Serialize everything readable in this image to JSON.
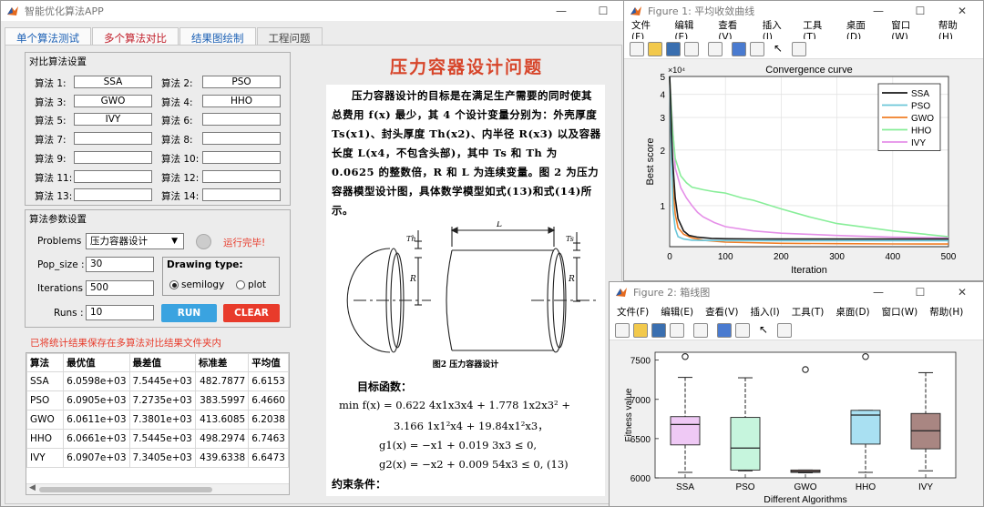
{
  "app": {
    "title": "智能优化算法APP",
    "tabs": [
      "单个算法测试",
      "多个算法对比",
      "结果图绘制",
      "工程问题"
    ],
    "tab_colors": [
      "#1a5fb4",
      "#c01c28",
      "#1a5fb4",
      "#444444"
    ],
    "page_heading": "压力容器设计问题",
    "compare_panel": {
      "title": "对比算法设置",
      "slots": [
        {
          "label": "算法 1:",
          "value": "SSA"
        },
        {
          "label": "算法 2:",
          "value": "PSO"
        },
        {
          "label": "算法 3:",
          "value": "GWO"
        },
        {
          "label": "算法 4:",
          "value": "HHO"
        },
        {
          "label": "算法 5:",
          "value": "IVY"
        },
        {
          "label": "算法 6:",
          "value": ""
        },
        {
          "label": "算法 7:",
          "value": ""
        },
        {
          "label": "算法 8:",
          "value": ""
        },
        {
          "label": "算法 9:",
          "value": ""
        },
        {
          "label": "算法 10:",
          "value": ""
        },
        {
          "label": "算法 11:",
          "value": ""
        },
        {
          "label": "算法 12:",
          "value": ""
        },
        {
          "label": "算法 13:",
          "value": ""
        },
        {
          "label": "算法 14:",
          "value": ""
        }
      ]
    },
    "param_panel": {
      "title": "算法参数设置",
      "problems_label": "Problems :",
      "problems_value": "压力容器设计",
      "status": "运行完毕!",
      "pop_label": "Pop_size :",
      "pop_value": "30",
      "iter_label": "Iterations :",
      "iter_value": "500",
      "runs_label": "Runs :",
      "runs_value": "10",
      "drawing_label": "Drawing type:",
      "opt_semilogy": "semilogy",
      "opt_plot": "plot",
      "run_label": "RUN",
      "clear_label": "CLEAR"
    },
    "save_note": "已将统计结果保存在多算法对比结果文件夹内",
    "table": {
      "headers": [
        "算法",
        "最优值",
        "最差值",
        "标准差",
        "平均值"
      ],
      "rows": [
        [
          "SSA",
          "6.0598e+03",
          "7.5445e+03",
          "482.7877",
          "6.6153"
        ],
        [
          "PSO",
          "6.0905e+03",
          "7.2735e+03",
          "383.5997",
          "6.4660"
        ],
        [
          "GWO",
          "6.0611e+03",
          "7.3801e+03",
          "413.6085",
          "6.2038"
        ],
        [
          "HHO",
          "6.0661e+03",
          "7.5445e+03",
          "498.2974",
          "6.7463"
        ],
        [
          "IVY",
          "6.0907e+03",
          "7.3405e+03",
          "439.6338",
          "6.6473"
        ]
      ]
    }
  },
  "doc": {
    "para": "压力容器设计的目标是在满足生产需要的同时使其总费用 f(x) 最少，其 4 个设计变量分别为：外壳厚度 Ts(x1)、封头厚度 Th(x2)、内半径 R(x3) 以及容器长度 L(x4，不包含头部)，其中 Ts 和 Th 为 0.0625 的整数倍，R 和 L 为连续变量。图 2 为压力容器模型设计图，具体数学模型如式(13)和式(14)所示。",
    "fig_caption": "图2  压力容器设计",
    "dim_L": "L",
    "dim_Ts": "Ts",
    "dim_Th": "Th",
    "dim_R": "R",
    "obj_title": "目标函数：",
    "eq1": "min f(x) = 0.622 4x1x3x4 + 1.778 1x2x3² +",
    "eq2": "3.166 1x1²x4 + 19.84x1²x3，",
    "eq3": "g1(x) = −x1 + 0.019 3x3 ≤ 0,",
    "eq4": "g2(x) = −x2 + 0.009 54x3 ≤ 0,      (13)",
    "cons_title": "约束条件："
  },
  "fig1": {
    "title": "Figure 1: 平均收敛曲线",
    "menu": [
      "文件(F)",
      "编辑(E)",
      "查看(V)",
      "插入(I)",
      "工具(T)",
      "桌面(D)",
      "窗口(W)",
      "帮助(H)"
    ],
    "plot_title": "Convergence curve",
    "xlabel": "Iteration",
    "ylabel": "Best score",
    "exponent": "×10⁴",
    "yticks": [
      "5",
      "4",
      "3",
      "2",
      "1"
    ],
    "xticks": [
      "0",
      "100",
      "200",
      "300",
      "400",
      "500"
    ]
  },
  "fig2": {
    "title": "Figure 2: 箱线图",
    "menu": [
      "文件(F)",
      "编辑(E)",
      "查看(V)",
      "插入(I)",
      "工具(T)",
      "桌面(D)",
      "窗口(W)",
      "帮助(H)"
    ],
    "xlabel": "Different Algorithms",
    "ylabel": "Fitness value",
    "yticks": [
      "7500",
      "7000",
      "6500",
      "6000"
    ]
  },
  "colors": {
    "accent": "#1a5fb4",
    "red": "#e83b2b",
    "run_btn": "#3aa3e0"
  },
  "chart_data": [
    {
      "type": "line",
      "title": "Convergence curve",
      "xlabel": "Iteration",
      "ylabel": "Best score",
      "xlim": [
        0,
        500
      ],
      "ylim": [
        6000,
        50000
      ],
      "yscale": "log",
      "legend": "top-right",
      "series": [
        {
          "name": "SSA",
          "color": "#1a1a1a",
          "x": [
            0,
            5,
            10,
            15,
            25,
            35,
            50,
            75,
            100,
            150,
            200,
            300,
            400,
            500
          ],
          "y": [
            50000,
            18000,
            11000,
            8500,
            7300,
            6900,
            6750,
            6650,
            6620,
            6610,
            6600,
            6600,
            6600,
            6600
          ]
        },
        {
          "name": "PSO",
          "color": "#6cc6d9",
          "x": [
            0,
            3,
            6,
            10,
            15,
            25,
            40,
            60,
            100,
            200,
            300,
            400,
            500
          ],
          "y": [
            50000,
            20000,
            9500,
            7500,
            6800,
            6600,
            6500,
            6480,
            6470,
            6466,
            6466,
            6466,
            6466
          ]
        },
        {
          "name": "GWO",
          "color": "#f07e26",
          "x": [
            0,
            5,
            10,
            15,
            25,
            40,
            60,
            100,
            200,
            300,
            400,
            500
          ],
          "y": [
            50000,
            14000,
            9000,
            7600,
            7000,
            6700,
            6500,
            6350,
            6260,
            6230,
            6210,
            6204
          ]
        },
        {
          "name": "HHO",
          "color": "#88ee99",
          "x": [
            0,
            5,
            10,
            20,
            30,
            40,
            60,
            80,
            100,
            130,
            150,
            200,
            250,
            300,
            350,
            400,
            450,
            500
          ],
          "y": [
            50000,
            26000,
            18000,
            14500,
            13300,
            12600,
            12200,
            11900,
            11700,
            11000,
            10700,
            9600,
            8700,
            8000,
            7650,
            7300,
            7050,
            6800
          ]
        },
        {
          "name": "IVY",
          "color": "#e58fe8",
          "x": [
            0,
            10,
            20,
            30,
            40,
            50,
            60,
            80,
            100,
            150,
            200,
            250,
            300,
            400,
            500
          ],
          "y": [
            50000,
            16000,
            12500,
            11000,
            10000,
            9200,
            8700,
            8100,
            7700,
            7300,
            7100,
            7000,
            6900,
            6750,
            6700
          ]
        }
      ]
    },
    {
      "type": "box",
      "xlabel": "Different Algorithms",
      "ylabel": "Fitness value",
      "ylim": [
        6000,
        7600
      ],
      "categories": [
        "SSA",
        "PSO",
        "GWO",
        "HHO",
        "IVY"
      ],
      "colors": [
        "#efc9f5",
        "#c6f5dd",
        "#a98682",
        "#a9e0f2",
        "#a98682"
      ],
      "boxes": [
        {
          "whisker_low": 6070,
          "q1": 6420,
          "median": 6680,
          "q3": 6780,
          "whisker_high": 7280,
          "outliers": [
            7545
          ]
        },
        {
          "whisker_low": 6090,
          "q1": 6100,
          "median": 6380,
          "q3": 6770,
          "whisker_high": 7275,
          "outliers": []
        },
        {
          "whisker_low": 6065,
          "q1": 6070,
          "median": 6080,
          "q3": 6100,
          "whisker_high": 6100,
          "outliers": [
            7380
          ]
        },
        {
          "whisker_low": 6070,
          "q1": 6430,
          "median": 6800,
          "q3": 6860,
          "whisker_high": 6860,
          "outliers": [
            7545
          ]
        },
        {
          "whisker_low": 6090,
          "q1": 6370,
          "median": 6600,
          "q3": 6820,
          "whisker_high": 7340,
          "outliers": []
        }
      ]
    }
  ]
}
